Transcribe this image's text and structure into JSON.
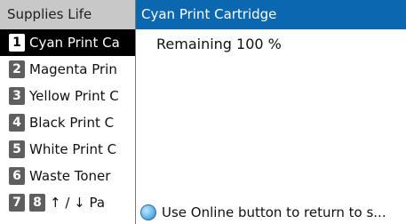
{
  "left_panel": {
    "title": "Supplies Life",
    "items": [
      {
        "num": "1",
        "label": "Cyan Print Ca"
      },
      {
        "num": "2",
        "label": "Magenta Prin"
      },
      {
        "num": "3",
        "label": "Yellow Print C"
      },
      {
        "num": "4",
        "label": "Black Print C"
      },
      {
        "num": "5",
        "label": "White Print C"
      },
      {
        "num": "6",
        "label": "Waste Toner"
      }
    ],
    "nav": {
      "num_a": "7",
      "num_b": "8",
      "label": "↑ / ↓ Pa"
    }
  },
  "right_panel": {
    "title": "Cyan Print Cartridge",
    "remaining": "Remaining 100 %",
    "footer_text": "Use Online button to return to s..."
  },
  "colors": {
    "header_blue": "#0b67b0",
    "selected_bg": "#000000",
    "title_gray": "#c8c8c8",
    "badge_gray": "#5f5f5f"
  }
}
